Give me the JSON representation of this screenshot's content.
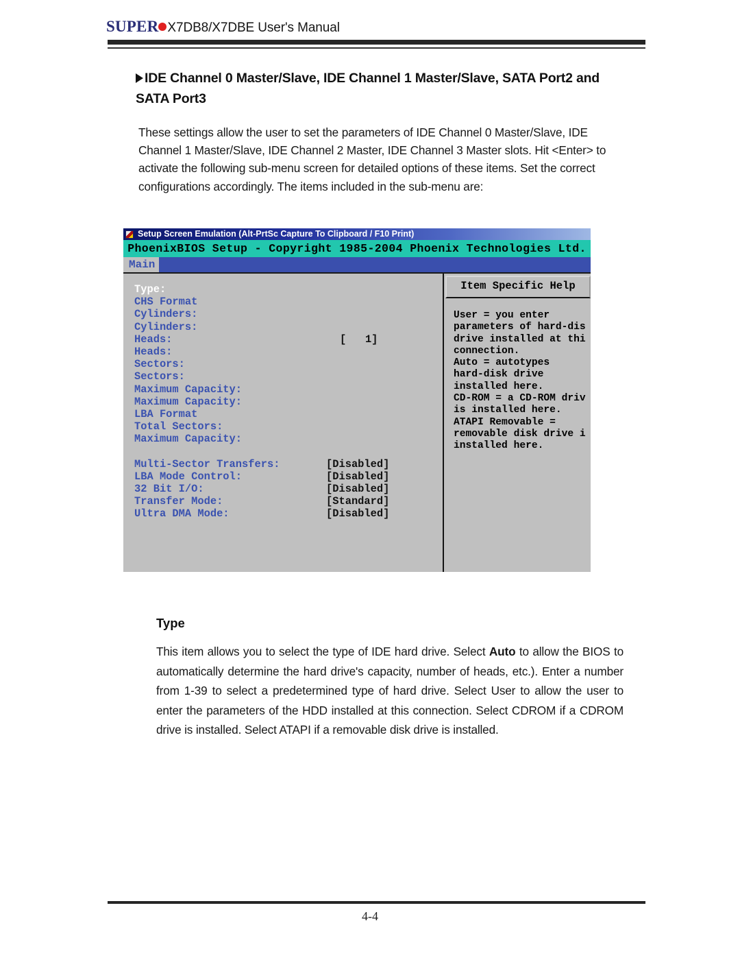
{
  "header": {
    "logo_brand": "SUPER",
    "logo_dot": "red-dot-icon",
    "manual_title": "X7DB8/X7DBE User's Manual",
    "brand_color": "#2b2f77",
    "dot_color": "#e02020"
  },
  "section": {
    "bullet": "triangle-right-icon",
    "heading": "IDE Channel 0 Master/Slave, IDE Channel 1 Master/Slave, SATA Port2 and SATA Port3",
    "intro_paragraph": "These settings allow the user to set the parameters of  IDE Channel 0 Master/Slave, IDE Channel 1 Master/Slave, IDE Channel 2 Master, IDE Channel 3 Master slots.  Hit <Enter> to activate  the following sub-menu screen for detailed options of these items. Set the correct configurations accordingly.  The items included in the sub-menu are:"
  },
  "bios": {
    "titlebar": "Setup Screen Emulation (Alt-PrtSc Capture To Clipboard / F10 Print)",
    "banner": "PhoenixBIOS Setup - Copyright 1985-2004 Phoenix Technologies Ltd.",
    "tab": "Main",
    "colors": {
      "titlebar_start": "#0b1668",
      "titlebar_end": "#9fb8e4",
      "banner_bg": "#22c7ae",
      "menubar_bg": "#3a4fad",
      "panel_bg": "#c0c0c0",
      "label_blue": "#3a52b0",
      "selected_white": "#ffffff"
    },
    "rows": [
      {
        "label": "Type:",
        "value": "",
        "selected": true
      },
      {
        "label": "CHS Format",
        "value": "",
        "selected": false
      },
      {
        "label": "Cylinders:",
        "value": "",
        "selected": false
      },
      {
        "label": "Cylinders:",
        "value": "",
        "selected": false
      },
      {
        "label": "Heads:",
        "value": "[   1]",
        "selected": false
      },
      {
        "label": "Heads:",
        "value": "",
        "selected": false
      },
      {
        "label": "Sectors:",
        "value": "",
        "selected": false
      },
      {
        "label": "Sectors:",
        "value": "",
        "selected": false
      },
      {
        "label": "Maximum Capacity:",
        "value": "",
        "selected": false
      },
      {
        "label": "Maximum Capacity:",
        "value": "",
        "selected": false
      },
      {
        "label": "LBA Format",
        "value": "",
        "selected": false
      },
      {
        "label": "Total Sectors:",
        "value": "",
        "selected": false
      },
      {
        "label": "Maximum Capacity:",
        "value": "",
        "selected": false
      }
    ],
    "rows2": [
      {
        "label": "Multi-Sector Transfers:",
        "value": "[Disabled]"
      },
      {
        "label": "LBA Mode Control:",
        "value": "[Disabled]"
      },
      {
        "label": "32 Bit I/O:",
        "value": "[Disabled]"
      },
      {
        "label": "Transfer Mode:",
        "value": "[Standard]"
      },
      {
        "label": "Ultra DMA Mode:",
        "value": "[Disabled]"
      }
    ],
    "help_title": "Item Specific Help",
    "help_text": "User = you enter\nparameters of hard-dis\ndrive installed at thi\nconnection.\nAuto = autotypes\nhard-disk drive\ninstalled here.\nCD-ROM = a CD-ROM driv\nis installed here.\nATAPI Removable =\nremovable disk drive i\ninstalled here."
  },
  "type_section": {
    "heading": "Type",
    "paragraph_1": "This item allows you to select the type of IDE hard drive. Select ",
    "bold_word": "Auto",
    "paragraph_2": " to allow the BIOS to automatically determine the hard drive's capacity, number of heads, etc.). Enter a number from 1-39 to select a predetermined type of hard drive. Select User to allow the user to enter the parameters of the HDD installed at this connection. Select CDROM if a CDROM drive is installed. Select ATAPI if a removable disk drive is installed."
  },
  "footer": {
    "page_number": "4-4"
  }
}
